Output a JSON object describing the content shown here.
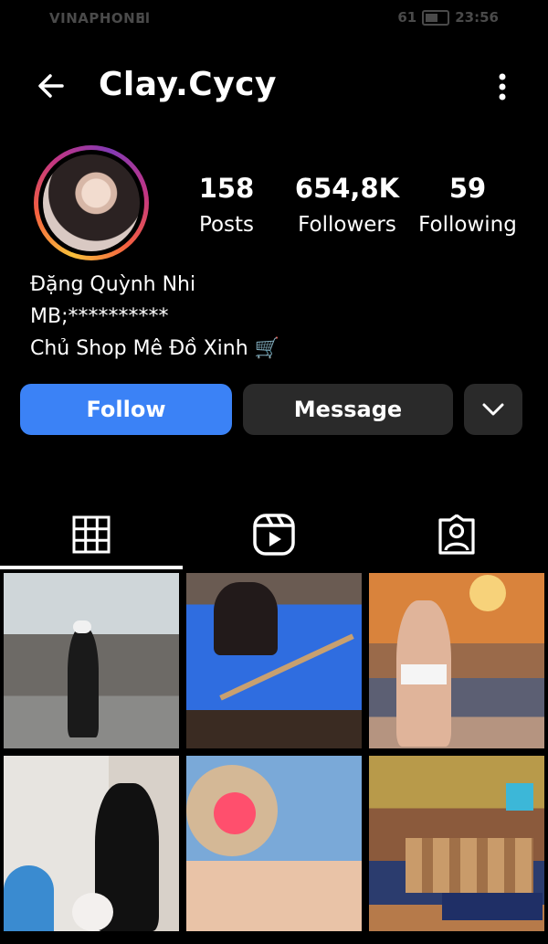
{
  "status_bar": {
    "carrier": "VINAPHONE",
    "battery": "61",
    "time": "23:56"
  },
  "header": {
    "username": "Clay.Cycy",
    "back_icon": "back-arrow-icon",
    "more_icon": "more-vertical-icon"
  },
  "profile": {
    "stats": [
      {
        "value": "158",
        "label": "Posts"
      },
      {
        "value": "654,8K",
        "label": "Followers"
      },
      {
        "value": "59",
        "label": "Following"
      }
    ],
    "bio": [
      "Đặng Quỳnh Nhi",
      "MB;**********",
      "Chủ Shop Mê Đồ Xinh 🛒"
    ]
  },
  "actions": {
    "follow_label": "Follow",
    "message_label": "Message"
  },
  "tabs": [
    {
      "icon": "grid-icon",
      "active": true
    },
    {
      "icon": "reels-icon",
      "active": false
    },
    {
      "icon": "tagged-icon",
      "active": false
    }
  ],
  "colors": {
    "accent": "#3b82f6",
    "button_dark": "#2a2a2a",
    "background": "#000000"
  }
}
